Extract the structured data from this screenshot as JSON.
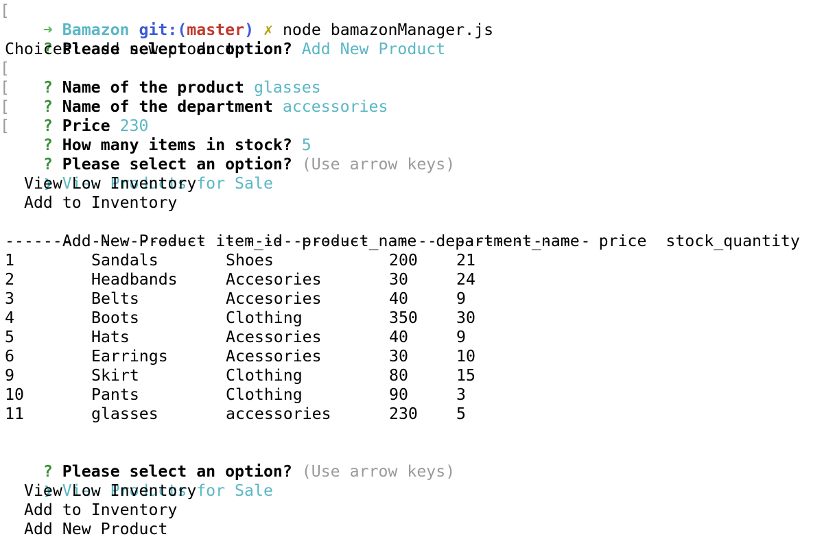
{
  "prompt": {
    "arrow": "➜",
    "dir": "Bamazon",
    "git_prefix": "git:(",
    "branch": "master",
    "git_suffix": ")",
    "dirty_mark": "✗",
    "command": "node bamazonManager.js"
  },
  "session1": {
    "q_mark": "?",
    "question": "Please select an option?",
    "answer": "Add New Product",
    "choices_line": "Choices: add new product",
    "bracket": "[",
    "name_q": "Name of the product",
    "name_a": "glasses",
    "dept_q": "Name of the department",
    "dept_a": "accessories",
    "price_q": "Price",
    "price_a": "230",
    "stock_q": "How many items in stock?",
    "stock_a": "5",
    "select_q": "Please select an option?",
    "hint": "(Use arrow keys)",
    "pointer": "❯",
    "options": [
      "View Products for Sale",
      "View Low Inventory",
      "Add to Inventory",
      "Add New Product"
    ]
  },
  "table": {
    "headers": [
      "item_id",
      "product_name",
      "department_name",
      "price",
      "stock_quantity"
    ],
    "separators": [
      "-------",
      "------------",
      "---------------",
      "-----",
      "--------------"
    ],
    "rows": [
      [
        "1",
        "Sandals",
        "Shoes",
        "200",
        "21"
      ],
      [
        "2",
        "Headbands",
        "Accesories",
        "30",
        "24"
      ],
      [
        "3",
        "Belts",
        "Accesories",
        "40",
        "9"
      ],
      [
        "4",
        "Boots",
        "Clothing",
        "350",
        "30"
      ],
      [
        "5",
        "Hats",
        "Acessories",
        "40",
        "9"
      ],
      [
        "6",
        "Earrings",
        "Acessories",
        "30",
        "10"
      ],
      [
        "9",
        "Skirt",
        "Clothing",
        "80",
        "15"
      ],
      [
        "10",
        "Pants",
        "Clothing",
        "90",
        "3"
      ],
      [
        "11",
        "glasses",
        "accessories",
        "230",
        "5"
      ]
    ]
  },
  "session2": {
    "q_mark": "?",
    "select_q": "Please select an option?",
    "hint": "(Use arrow keys)",
    "pointer": "❯",
    "options": [
      "View Products for Sale",
      "View Low Inventory",
      "Add to Inventory",
      "Add New Product"
    ]
  },
  "colors": {
    "prompt_arrow": "#5cb85c",
    "dir": "#5ab7c4",
    "git": "#3c5ad8",
    "branch": "#c0392b",
    "dirty": "#b8a000",
    "answer": "#5ab7c4",
    "hint": "#9a9a9a"
  }
}
